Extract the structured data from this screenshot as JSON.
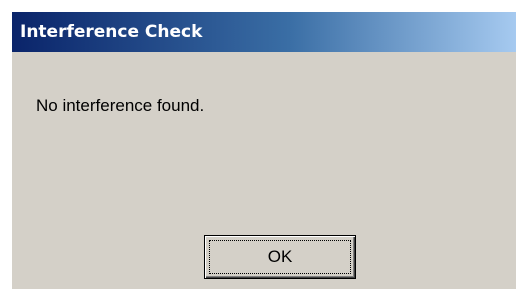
{
  "window": {
    "title": "Interference Check"
  },
  "dialog": {
    "message": "No interference found.",
    "ok_label": "OK"
  }
}
